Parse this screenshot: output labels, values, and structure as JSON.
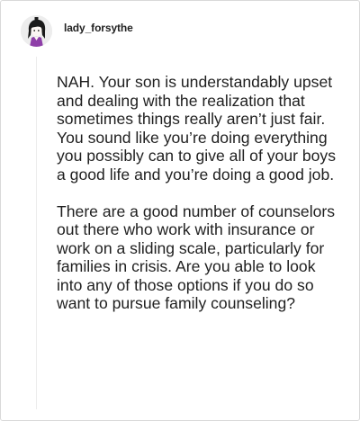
{
  "post": {
    "username": "lady_forsythe",
    "paragraphs": [
      "NAH. Your son is understandably upset and dealing with the realization that sometimes things really aren’t just fair. You sound like you’re doing everything you possibly can to give all of your boys a good life and you’re doing a good job.",
      "There are a good number of counselors out there who work with insurance or work on a sliding scale, particularly for families in crisis. Are you able to look into any of those options if you do so want to pursue family counseling?"
    ]
  },
  "colors": {
    "avatar_accent": "#8e3fa8",
    "text": "#1f1f1f",
    "border": "#d9d9d9"
  }
}
